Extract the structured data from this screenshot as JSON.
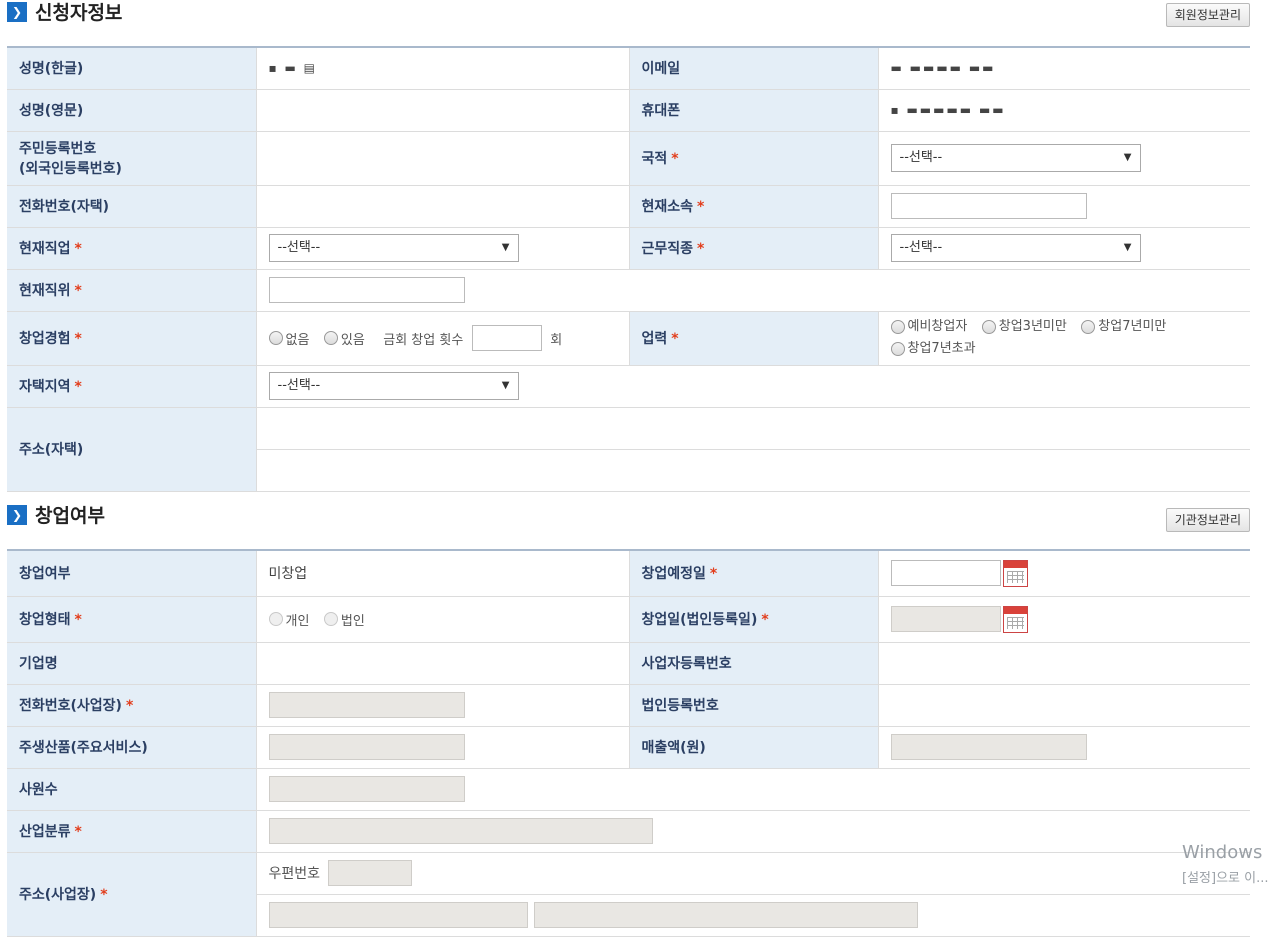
{
  "applicant": {
    "title": "신청자정보",
    "manage_button": "회원정보관리",
    "name_kr_label": "성명(한글)",
    "name_kr_value": "▪ ▬ ▤",
    "email_label": "이메일",
    "email_value": "▬   ▬▬▬▬ ▬▬",
    "name_en_label": "성명(영문)",
    "mobile_label": "휴대폰",
    "mobile_value": "▪ ▬▬▬▬▬ ▬▬",
    "rrn_label_1": "주민등록번호",
    "rrn_label_2": "(외국인등록번호)",
    "nationality_label": "국적",
    "nationality_value": "--선택--",
    "home_phone_label": "전화번호(자택)",
    "affiliation_label": "현재소속",
    "job_label": "현재직업",
    "job_value": "--선택--",
    "work_type_label": "근무직종",
    "work_type_value": "--선택--",
    "position_label": "현재직위",
    "startup_exp_label": "창업경험",
    "startup_exp_options": [
      "없음",
      "있음"
    ],
    "startup_count_label": "금회 창업 횟수",
    "startup_count_unit": "회",
    "career_label": "업력",
    "career_options": [
      "예비창업자",
      "창업3년미만",
      "창업7년미만",
      "창업7년초과"
    ],
    "home_region_label": "자택지역",
    "home_region_value": "--선택--",
    "home_address_label": "주소(자택)"
  },
  "startup": {
    "title": "창업여부",
    "manage_button": "기관정보관리",
    "status_label": "창업여부",
    "status_value": "미창업",
    "planned_date_label": "창업예정일",
    "form_label": "창업형태",
    "form_options": [
      "개인",
      "법인"
    ],
    "founded_date_label": "창업일(법인등록일)",
    "company_name_label": "기업명",
    "biz_reg_label": "사업자등록번호",
    "office_phone_label": "전화번호(사업장)",
    "corp_reg_label": "법인등록번호",
    "main_product_label": "주생산품(주요서비스)",
    "revenue_label": "매출액(원)",
    "employees_label": "사원수",
    "industry_label": "산업분류",
    "office_address_label": "주소(사업장)",
    "zipcode_label": "우편번호"
  },
  "watermark": {
    "line1": "Windows",
    "line2": "[설정]으로 이..."
  },
  "colors": {
    "label_bg": "#e4eef7",
    "label_text": "#2b3f63",
    "required": "#e23d1c",
    "section_icon": "#1a6fc4"
  }
}
